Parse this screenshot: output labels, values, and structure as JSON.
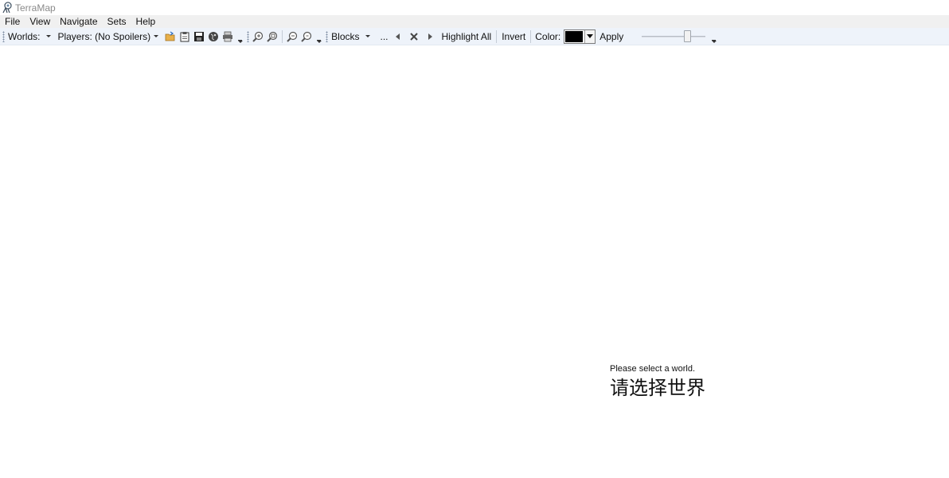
{
  "window": {
    "title": "TerraMap"
  },
  "menu": {
    "items": [
      "File",
      "View",
      "Navigate",
      "Sets",
      "Help"
    ]
  },
  "toolbar": {
    "worlds_label": "Worlds:",
    "players_label": "Players: (No Spoilers)",
    "blocks_label": "Blocks",
    "ellipsis_label": "...",
    "highlight_all_label": "Highlight All",
    "invert_label": "Invert",
    "color_label": "Color:",
    "apply_label": "Apply",
    "selected_color": "#000000",
    "slider_value": 0.75,
    "icons": [
      "open-folder-icon",
      "clipboard-icon",
      "save-icon",
      "globe-icon",
      "print-icon",
      "zoom-in-icon",
      "zoom-in-alt-icon",
      "zoom-out-icon",
      "zoom-out-alt-icon",
      "previous-icon",
      "close-icon",
      "next-icon"
    ]
  },
  "main": {
    "message_en": "Please select a world.",
    "message_zh": "请选择世界"
  }
}
